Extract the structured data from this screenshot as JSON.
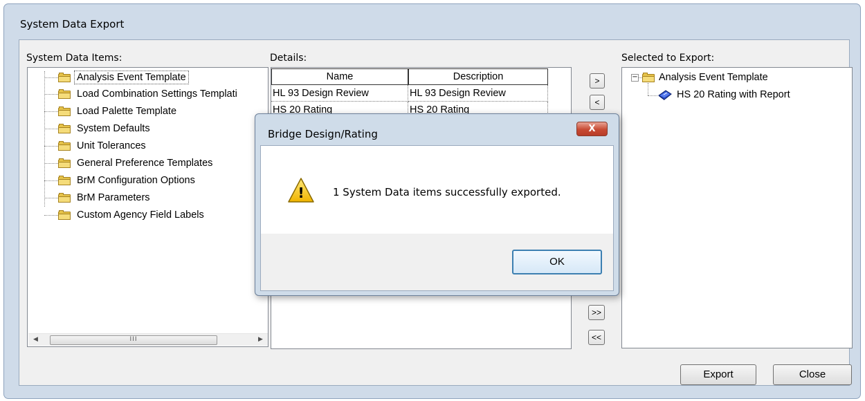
{
  "window": {
    "title": "System Data Export"
  },
  "system_items": {
    "label": "System Data Items:",
    "items": [
      "Analysis Event Template",
      "Load Combination Settings Templatі",
      "Load Palette Template",
      "System Defaults",
      "Unit Tolerances",
      "General Preference Templates",
      "BrM Configuration Options",
      "BrM Parameters",
      "Custom Agency Field Labels"
    ],
    "scroll_thumb_grip": "III"
  },
  "details": {
    "label": "Details:",
    "columns": [
      "Name",
      "Description"
    ],
    "rows": [
      [
        "HL 93 Design Review",
        "HL 93 Design Review"
      ],
      [
        "HS 20 Rating",
        "HS 20 Rating"
      ]
    ]
  },
  "transfer_buttons": {
    "add": ">",
    "remove": "<",
    "add_all": ">>",
    "remove_all": "<<"
  },
  "selected": {
    "label": "Selected to Export:",
    "parent": "Analysis Event Template",
    "expander": "−",
    "child": "HS 20 Rating with Report"
  },
  "buttons": {
    "export": "Export",
    "close": "Close"
  },
  "dialog": {
    "title": "Bridge Design/Rating",
    "close_glyph": "X",
    "message": "1 System Data items successfully exported.",
    "ok": "OK",
    "warning_glyph": "!"
  },
  "colors": {
    "accent": "#3c7fb1",
    "folder": "#e6c34a",
    "close_red": "#c74a33"
  }
}
